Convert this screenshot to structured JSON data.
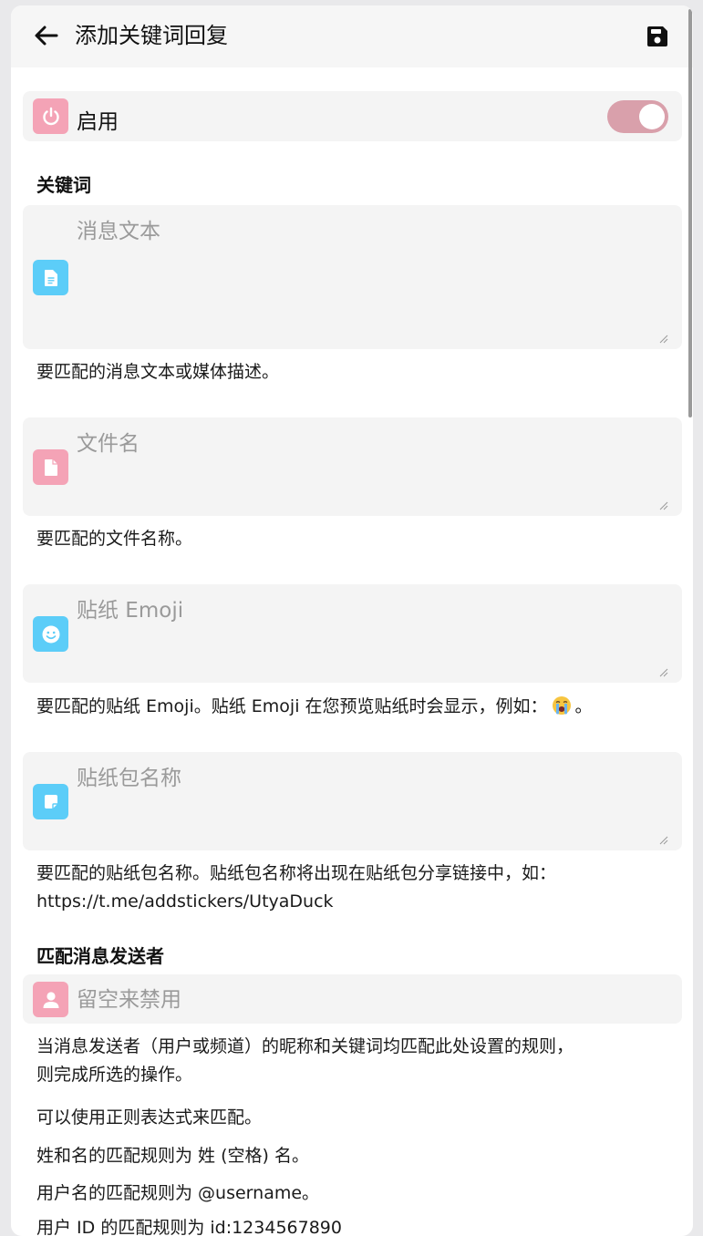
{
  "header": {
    "title": "添加关键词回复",
    "back_icon": "arrow-left-icon",
    "save_icon": "floppy-disk-icon"
  },
  "enable": {
    "label": "启用",
    "icon": "power-icon",
    "checked": true
  },
  "keywords": {
    "title": "关键词",
    "message_text": {
      "placeholder": "消息文本",
      "icon": "document-text-icon",
      "hint": "要匹配的消息文本或媒体描述。"
    },
    "file_name": {
      "placeholder": "文件名",
      "icon": "file-icon",
      "hint": "要匹配的文件名称。"
    },
    "sticker_emoji": {
      "placeholder": "贴纸 Emoji",
      "icon": "smiley-face-icon",
      "hint_before": "要匹配的贴纸 Emoji。贴纸 Emoji 在您预览贴纸时会显示，例如：",
      "hint_emoji": "crying-face-emoji",
      "hint_after": "。"
    },
    "sticker_pack": {
      "placeholder": "贴纸包名称",
      "icon": "sticker-icon",
      "hint_line1": "要匹配的贴纸包名称。贴纸包名称将出现在贴纸包分享链接中，如：",
      "hint_line2": "https://t.me/addstickers/UtyaDuck"
    }
  },
  "sender": {
    "title": "匹配消息发送者",
    "placeholder": "留空来禁用",
    "icon": "person-icon",
    "hint_line1": "当消息发送者（用户或频道）的昵称和关键词均匹配此处设置的规则，",
    "hint_line2": "则完成所选的操作。",
    "hint_regex": "可以使用正则表达式来匹配。",
    "hint_name": "姓和名的匹配规则为 姓 (空格) 名。",
    "hint_username": "用户名的匹配规则为 @username。",
    "hint_id_partial": "用户 ID 的匹配规则为 id:1234567890"
  },
  "colors": {
    "accent_pink": "#f4a3b6",
    "accent_blue": "#5ccdf8",
    "toggle_on": "#d9a0ab",
    "field_bg": "#f4f4f4"
  }
}
